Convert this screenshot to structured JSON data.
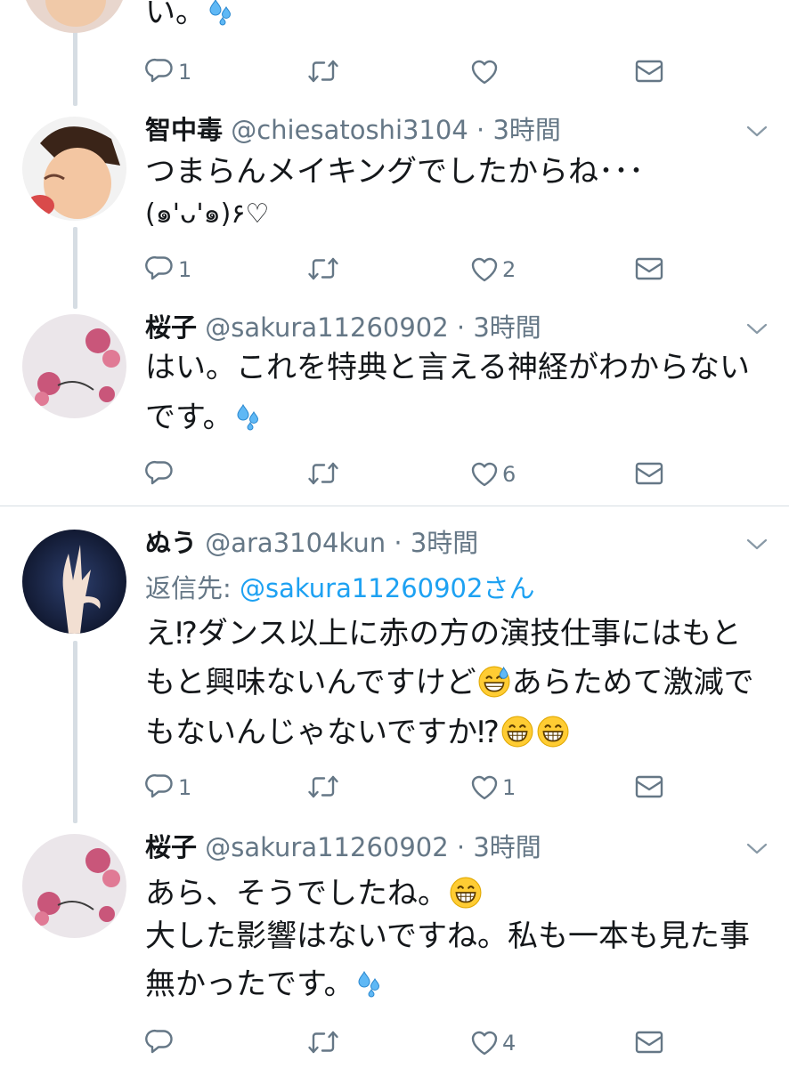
{
  "tweets": [
    {
      "body": [
        "い。"
      ],
      "replies": "1"
    },
    {
      "name": "智中毒",
      "handle": "@chiesatoshi3104",
      "time": "3時間",
      "body": [
        "つまらんメイキングでしたからね･･･",
        "(๑'ᴗ'๑)۶♡"
      ],
      "replies": "1",
      "likes": "2"
    },
    {
      "name": "桜子",
      "handle": "@sakura11260902",
      "time": "3時間",
      "body": [
        "はい。これを特典と言える神経がわからない",
        "です。"
      ],
      "likes": "6"
    },
    {
      "name": "ぬう",
      "handle": "@ara3104kun",
      "time": "3時間",
      "reply_to_label": "返信先: ",
      "reply_to_handle": "@sakura11260902さん",
      "body": [
        "え⁉ダンス以上に赤の方の演技仕事にはもと",
        "もと興味ないんですけど",
        "あらためて激減で",
        "もないんじゃないですか⁉"
      ],
      "replies": "1",
      "likes": "1"
    },
    {
      "name": "桜子",
      "handle": "@sakura11260902",
      "time": "3時間",
      "body": [
        "あら、そうでしたね。",
        "大した影響はないですね。私も一本も見た事",
        "無かったです。"
      ],
      "likes": "4"
    }
  ],
  "separator": " · ",
  "icons": {
    "reply": "reply-icon",
    "retweet": "retweet-icon",
    "like": "heart-icon",
    "dm": "envelope-icon",
    "more": "chevron-down-icon",
    "emoji_sweat": "sweat-droplets-emoji",
    "emoji_grin_sweat": "grinning-face-with-sweat-emoji",
    "emoji_grin": "grinning-face-emoji"
  },
  "colors": {
    "text": "#14171a",
    "secondary": "#657786",
    "link": "#1da1f2",
    "thread_line": "#d6dde3"
  }
}
